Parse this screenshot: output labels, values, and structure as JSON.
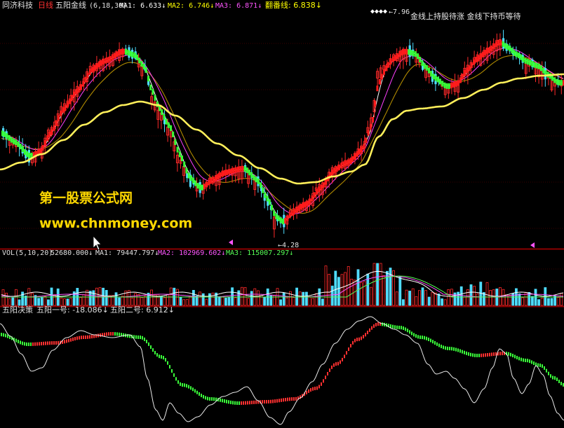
{
  "colors": {
    "background": "#000000",
    "frame": "#8b0000",
    "up": "#ff2a2a",
    "down_candle": "#4fdcff",
    "golden_line": "#ffef5a",
    "buy_strip": "#ff1a1a",
    "sell_strip": "#35ff35",
    "ma1": "#ffffff",
    "ma2": "#ff3fff",
    "ma3": "#ffff00",
    "label_yellow": "#ffff00",
    "label_magenta": "#ff55ff",
    "label_white": "#e0e0e0",
    "watermark": "#ffd800"
  },
  "header": {
    "stock_name": "同济科技",
    "period": "日线",
    "indicator_name": "五阳金线",
    "indicator_params": "(6,18,30)",
    "ma1": "MA1: 6.633↓",
    "ma2": "MA2: 6.746↓",
    "ma3": "MA3: 6.871↓",
    "fanfan": "翻番线: 6.838↓"
  },
  "price_panel": {
    "high_label": "7.96",
    "low_label": "4.28",
    "annotation": "金线上持股待涨  金线下持币等待"
  },
  "volume_panel": {
    "title": "VOL(5,10,20)",
    "vol": "52680.000↓",
    "ma1": "MA1: 79447.797↓",
    "ma2": "MA2: 102969.602↓",
    "ma3": "MA3: 115007.297↓"
  },
  "decision_panel": {
    "title": "五阳决策",
    "line1": "五阳一号: -18.086↓",
    "line2": "五阳二号: 6.912↓"
  },
  "watermark": {
    "name": "第一股票公式网",
    "url": "www.chnmoney.com"
  },
  "chart_data": {
    "type": "line",
    "series": [
      {
        "name": "五阳金线",
        "y_range": [
          4.28,
          7.96
        ]
      },
      {
        "name": "五阳一号",
        "last": -18.086
      },
      {
        "name": "五阳二号",
        "last": 6.912
      }
    ]
  }
}
